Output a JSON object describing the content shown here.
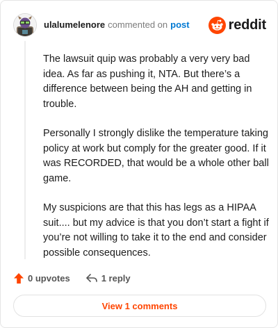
{
  "header": {
    "username": "ulalumelenore",
    "commented_text": "commented on",
    "post_link": "post",
    "brand_name": "reddit"
  },
  "comment": {
    "paragraphs": [
      "The lawsuit quip was probably a very very bad idea. As far as pushing it, NTA. But there’s a difference between being the AH and getting in trouble.",
      "Personally I strongly dislike the temperature taking policy at work but comply for the greater good. If it was RECORDED, that would be a whole other ball game.",
      "My suspicions are that this has legs as a HIPAA suit.... but my advice is that you don’t start a fight if you’re not willing to take it to the end and consider possible consequences."
    ]
  },
  "actions": {
    "upvotes_label": "0 upvotes",
    "reply_label": "1 reply"
  },
  "footer": {
    "view_comments_label": "View 1 comments"
  },
  "icons": {
    "avatar": "user-avatar",
    "brand": "reddit-snoo-icon",
    "upvote": "upvote-arrow-icon",
    "reply": "reply-arrow-icon"
  },
  "colors": {
    "brand_orange": "#ff4500",
    "link_blue": "#0079d3",
    "muted_text": "#7c7c7c"
  }
}
